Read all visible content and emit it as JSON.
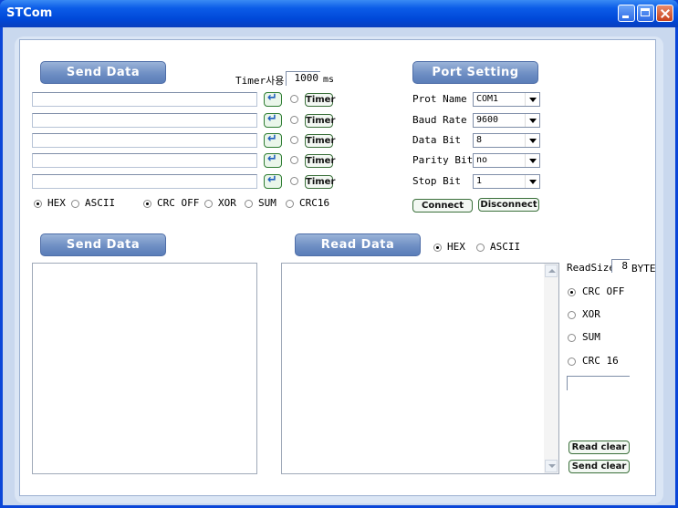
{
  "window": {
    "title": "STCom"
  },
  "send_panel": {
    "header": "Send Data",
    "timer_label": "Timer사용",
    "timer_value": "1000",
    "timer_unit": "ms",
    "enter_symbol": "↵",
    "timer_button_label": "Timer",
    "rows": [
      {
        "value": ""
      },
      {
        "value": ""
      },
      {
        "value": ""
      },
      {
        "value": ""
      },
      {
        "value": ""
      }
    ],
    "format_options": [
      {
        "label": "HEX",
        "selected": true
      },
      {
        "label": "ASCII",
        "selected": false
      }
    ],
    "crc_options": [
      {
        "label": "CRC OFF",
        "selected": true
      },
      {
        "label": "XOR",
        "selected": false
      },
      {
        "label": "SUM",
        "selected": false
      },
      {
        "label": "CRC16",
        "selected": false
      }
    ]
  },
  "port_setting": {
    "header": "Port Setting",
    "fields": [
      {
        "label": "Prot Name",
        "value": "COM1"
      },
      {
        "label": "Baud Rate",
        "value": "9600"
      },
      {
        "label": "Data Bit",
        "value": "8"
      },
      {
        "label": "Parity Bit",
        "value": "no"
      },
      {
        "label": "Stop Bit",
        "value": "1"
      }
    ],
    "connect_label": "Connect",
    "disconnect_label": "Disconnect"
  },
  "send_log": {
    "header": "Send Data",
    "content": ""
  },
  "read_log": {
    "header": "Read Data",
    "format_options": [
      {
        "label": "HEX",
        "selected": true
      },
      {
        "label": "ASCII",
        "selected": false
      }
    ],
    "content": ""
  },
  "read_settings": {
    "readsize_label": "ReadSize",
    "readsize_value": "8",
    "readsize_unit": "BYTE",
    "crc_options": [
      {
        "label": "CRC OFF",
        "selected": true
      },
      {
        "label": "XOR",
        "selected": false
      },
      {
        "label": "SUM",
        "selected": false
      },
      {
        "label": "CRC 16",
        "selected": false
      }
    ],
    "result_value": "",
    "read_clear_label": "Read clear",
    "send_clear_label": "Send clear"
  }
}
